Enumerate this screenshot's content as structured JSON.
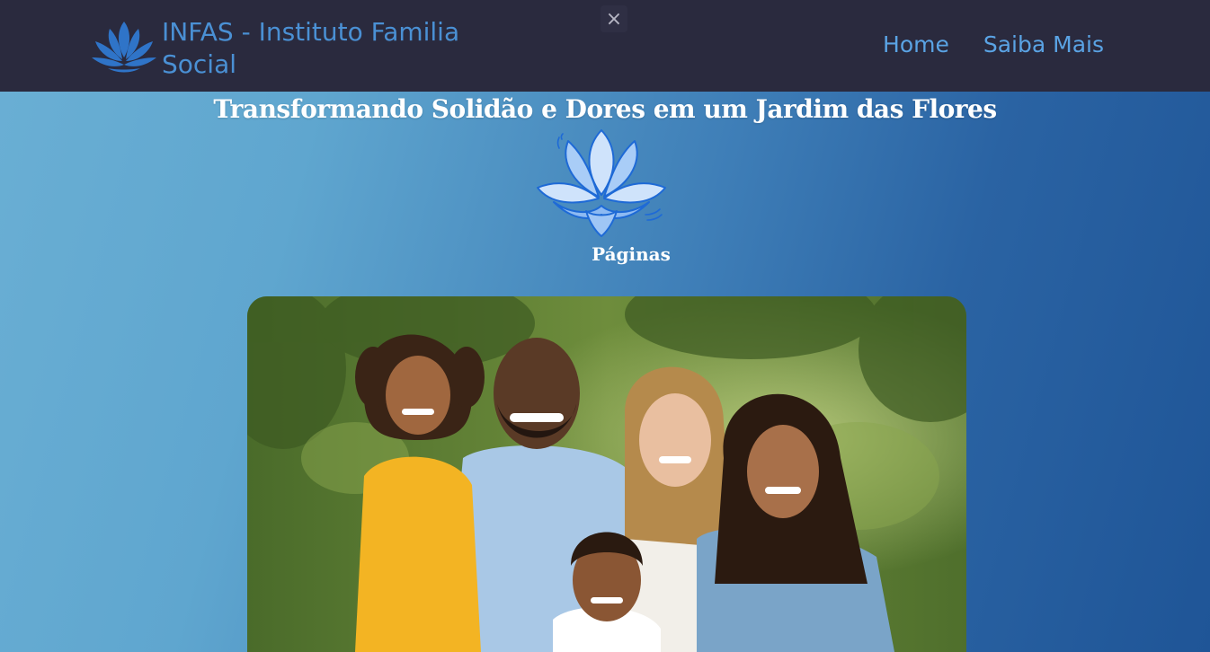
{
  "navbar": {
    "brand_name": "INFAS - Instituto Familia Social",
    "logo_icon": "lotus-icon",
    "close_label": "×",
    "links": [
      {
        "label": "Home"
      },
      {
        "label": "Saiba Mais"
      }
    ]
  },
  "hero": {
    "title": "Transformando Solidão e Dores em um Jardim das Flores",
    "lotus_icon": "lotus-icon",
    "pages_label": "Páginas"
  },
  "photo": {
    "subject": "family-photo",
    "alt": ""
  },
  "colors": {
    "navbar_bg": "#2a2a3e",
    "brand": "#4a90d4",
    "nav_link": "#5aa3e4",
    "hero_text": "#ffffff"
  }
}
